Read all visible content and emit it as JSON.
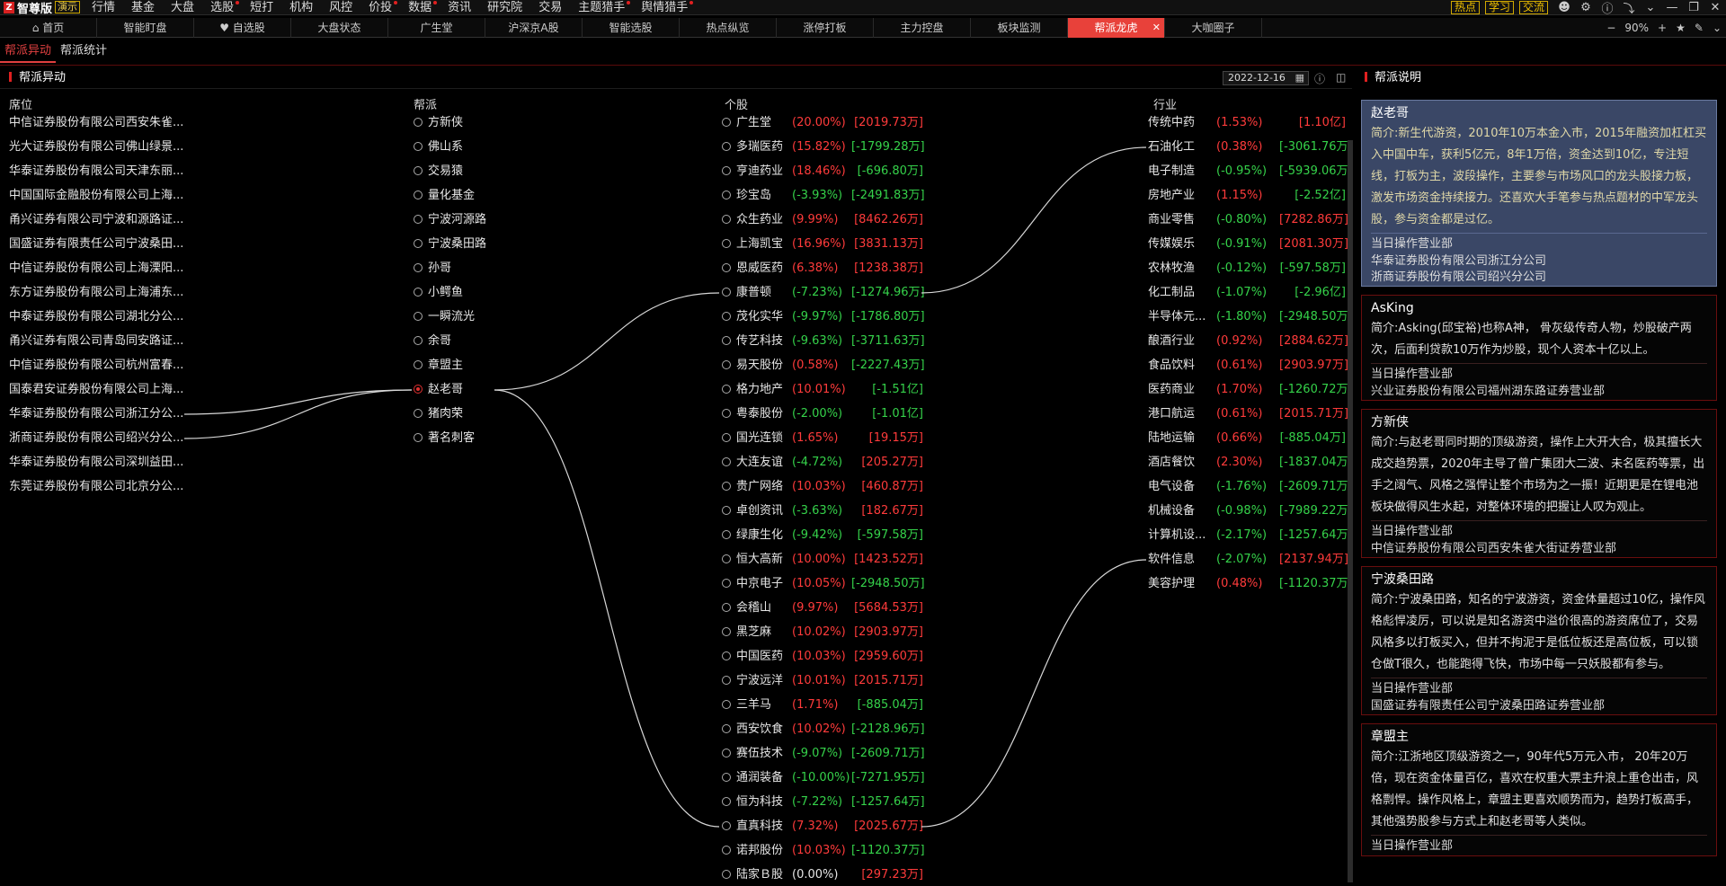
{
  "app": {
    "name": "智尊版",
    "badge": "演示"
  },
  "menu": [
    "行情",
    "基金",
    "大盘",
    "选股",
    "短打",
    "机构",
    "风控",
    "价投",
    "数据",
    "资讯",
    "研究院",
    "交易",
    "主题猎手",
    "舆情猎手"
  ],
  "top_right": {
    "hot": "热点",
    "learn": "学习",
    "exchange": "交流"
  },
  "tabs": [
    "首页",
    "智能盯盘",
    "自选股",
    "大盘状态",
    "广生堂",
    "沪深京A股",
    "智能选股",
    "热点纵览",
    "涨停打板",
    "主力控盘",
    "板块监测",
    "帮派龙虎",
    "大咖圈子"
  ],
  "tabbar_right": {
    "minus": "−",
    "zoom": "90%",
    "plus": "+"
  },
  "subtabs": [
    "帮派异动",
    "帮派统计"
  ],
  "left_panel": {
    "title": "帮派异动",
    "date": "2022-12-16"
  },
  "columns": {
    "seat": "席位",
    "faction": "帮派",
    "stock": "个股",
    "industry": "行业"
  },
  "seats": [
    "中信证券股份有限公司西安朱雀...",
    "光大证券股份有限公司佛山绿景...",
    "华泰证券股份有限公司天津东丽...",
    "中国国际金融股份有限公司上海...",
    "甬兴证券有限公司宁波和源路证...",
    "国盛证券有限责任公司宁波桑田...",
    "中信证券股份有限公司上海溧阳...",
    "东方证券股份有限公司上海浦东...",
    "中泰证券股份有限公司湖北分公...",
    "甬兴证券有限公司青岛同安路证...",
    "中信证券股份有限公司杭州富春...",
    "国泰君安证券股份有限公司上海...",
    "华泰证券股份有限公司浙江分公...",
    "浙商证券股份有限公司绍兴分公...",
    "华泰证券股份有限公司深圳益田...",
    "东莞证券股份有限公司北京分公..."
  ],
  "factions": [
    "方新侠",
    "佛山系",
    "交易猿",
    "量化基金",
    "宁波河源路",
    "宁波桑田路",
    "孙哥",
    "小鳄鱼",
    "一瞬流光",
    "余哥",
    "章盟主",
    "赵老哥",
    "猪肉荣",
    "著名刺客"
  ],
  "selected_faction": "赵老哥",
  "stocks": [
    {
      "name": "广生堂",
      "pct": "(20.00%)",
      "amt": "[2019.73万]",
      "pc": "red",
      "ac": "red"
    },
    {
      "name": "多瑞医药",
      "pct": "(15.82%)",
      "amt": "[-1799.28万]",
      "pc": "red",
      "ac": "green"
    },
    {
      "name": "亨迪药业",
      "pct": "(18.46%)",
      "amt": "[-696.80万]",
      "pc": "red",
      "ac": "green"
    },
    {
      "name": "珍宝岛",
      "pct": "(-3.93%)",
      "amt": "[-2491.83万]",
      "pc": "green",
      "ac": "green"
    },
    {
      "name": "众生药业",
      "pct": "(9.99%)",
      "amt": "[8462.26万]",
      "pc": "red",
      "ac": "red"
    },
    {
      "name": "上海凯宝",
      "pct": "(16.96%)",
      "amt": "[3831.13万]",
      "pc": "red",
      "ac": "red"
    },
    {
      "name": "恩威医药",
      "pct": "(6.38%)",
      "amt": "[1238.38万]",
      "pc": "red",
      "ac": "red"
    },
    {
      "name": "康普顿",
      "pct": "(-7.23%)",
      "amt": "[-1274.96万]",
      "pc": "green",
      "ac": "green"
    },
    {
      "name": "茂化实华",
      "pct": "(-9.97%)",
      "amt": "[-1786.80万]",
      "pc": "green",
      "ac": "green"
    },
    {
      "name": "传艺科技",
      "pct": "(-9.63%)",
      "amt": "[-3711.63万]",
      "pc": "green",
      "ac": "green"
    },
    {
      "name": "易天股份",
      "pct": "(0.58%)",
      "amt": "[-2227.43万]",
      "pc": "red",
      "ac": "green"
    },
    {
      "name": "格力地产",
      "pct": "(10.01%)",
      "amt": "[-1.51亿]",
      "pc": "red",
      "ac": "green"
    },
    {
      "name": "粤泰股份",
      "pct": "(-2.00%)",
      "amt": "[-1.01亿]",
      "pc": "green",
      "ac": "green"
    },
    {
      "name": "国光连锁",
      "pct": "(1.65%)",
      "amt": "[19.15万]",
      "pc": "red",
      "ac": "red"
    },
    {
      "name": "大连友谊",
      "pct": "(-4.72%)",
      "amt": "[205.27万]",
      "pc": "green",
      "ac": "red"
    },
    {
      "name": "贵广网络",
      "pct": "(10.03%)",
      "amt": "[460.87万]",
      "pc": "red",
      "ac": "red"
    },
    {
      "name": "卓创资讯",
      "pct": "(-3.63%)",
      "amt": "[182.67万]",
      "pc": "green",
      "ac": "red"
    },
    {
      "name": "绿康生化",
      "pct": "(-9.42%)",
      "amt": "[-597.58万]",
      "pc": "green",
      "ac": "green"
    },
    {
      "name": "恒大高新",
      "pct": "(10.00%)",
      "amt": "[1423.52万]",
      "pc": "red",
      "ac": "red"
    },
    {
      "name": "中京电子",
      "pct": "(10.05%)",
      "amt": "[-2948.50万]",
      "pc": "red",
      "ac": "green"
    },
    {
      "name": "会稽山",
      "pct": "(9.97%)",
      "amt": "[5684.53万]",
      "pc": "red",
      "ac": "red"
    },
    {
      "name": "黑芝麻",
      "pct": "(10.02%)",
      "amt": "[2903.97万]",
      "pc": "red",
      "ac": "red"
    },
    {
      "name": "中国医药",
      "pct": "(10.03%)",
      "amt": "[2959.60万]",
      "pc": "red",
      "ac": "red"
    },
    {
      "name": "宁波远洋",
      "pct": "(10.01%)",
      "amt": "[2015.71万]",
      "pc": "red",
      "ac": "red"
    },
    {
      "name": "三羊马",
      "pct": "(1.71%)",
      "amt": "[-885.04万]",
      "pc": "red",
      "ac": "green"
    },
    {
      "name": "西安饮食",
      "pct": "(10.02%)",
      "amt": "[-2128.96万]",
      "pc": "red",
      "ac": "green"
    },
    {
      "name": "赛伍技术",
      "pct": "(-9.07%)",
      "amt": "[-2609.71万]",
      "pc": "green",
      "ac": "green"
    },
    {
      "name": "通润装备",
      "pct": "(-10.00%)",
      "amt": "[-7271.95万]",
      "pc": "green",
      "ac": "green"
    },
    {
      "name": "恒为科技",
      "pct": "(-7.22%)",
      "amt": "[-1257.64万]",
      "pc": "green",
      "ac": "green"
    },
    {
      "name": "直真科技",
      "pct": "(7.32%)",
      "amt": "[2025.67万]",
      "pc": "red",
      "ac": "red"
    },
    {
      "name": "诺邦股份",
      "pct": "(10.03%)",
      "amt": "[-1120.37万]",
      "pc": "red",
      "ac": "green"
    },
    {
      "name": "陆家Ｂ股",
      "pct": "(0.00%)",
      "amt": "[297.23万]",
      "pc": "white",
      "ac": "red"
    }
  ],
  "industries": [
    {
      "name": "传统中药",
      "pct": "(1.53%)",
      "amt": "[1.10亿]",
      "pc": "red",
      "ac": "red"
    },
    {
      "name": "石油化工",
      "pct": "(0.38%)",
      "amt": "[-3061.76万]",
      "pc": "red",
      "ac": "green"
    },
    {
      "name": "电子制造",
      "pct": "(-0.95%)",
      "amt": "[-5939.06万]",
      "pc": "green",
      "ac": "green"
    },
    {
      "name": "房地产业",
      "pct": "(1.15%)",
      "amt": "[-2.52亿]",
      "pc": "red",
      "ac": "green"
    },
    {
      "name": "商业零售",
      "pct": "(-0.80%)",
      "amt": "[7282.86万]",
      "pc": "green",
      "ac": "red"
    },
    {
      "name": "传媒娱乐",
      "pct": "(-0.91%)",
      "amt": "[2081.30万]",
      "pc": "green",
      "ac": "red"
    },
    {
      "name": "农林牧渔",
      "pct": "(-0.12%)",
      "amt": "[-597.58万]",
      "pc": "green",
      "ac": "green"
    },
    {
      "name": "化工制品",
      "pct": "(-1.07%)",
      "amt": "[-2.96亿]",
      "pc": "green",
      "ac": "green"
    },
    {
      "name": "半导体元...",
      "pct": "(-1.80%)",
      "amt": "[-2948.50万]",
      "pc": "green",
      "ac": "green"
    },
    {
      "name": "酿酒行业",
      "pct": "(0.92%)",
      "amt": "[2884.62万]",
      "pc": "red",
      "ac": "red"
    },
    {
      "name": "食品饮料",
      "pct": "(0.61%)",
      "amt": "[2903.97万]",
      "pc": "red",
      "ac": "red"
    },
    {
      "name": "医药商业",
      "pct": "(1.70%)",
      "amt": "[-1260.72万]",
      "pc": "red",
      "ac": "green"
    },
    {
      "name": "港口航运",
      "pct": "(0.61%)",
      "amt": "[2015.71万]",
      "pc": "red",
      "ac": "red"
    },
    {
      "name": "陆地运输",
      "pct": "(0.66%)",
      "amt": "[-885.04万]",
      "pc": "red",
      "ac": "green"
    },
    {
      "name": "酒店餐饮",
      "pct": "(2.30%)",
      "amt": "[-1837.04万]",
      "pc": "red",
      "ac": "green"
    },
    {
      "name": "电气设备",
      "pct": "(-1.76%)",
      "amt": "[-2609.71万]",
      "pc": "green",
      "ac": "green"
    },
    {
      "name": "机械设备",
      "pct": "(-0.98%)",
      "amt": "[-7989.22万]",
      "pc": "green",
      "ac": "green"
    },
    {
      "name": "计算机设...",
      "pct": "(-2.17%)",
      "amt": "[-1257.64万]",
      "pc": "green",
      "ac": "green"
    },
    {
      "name": "软件信息",
      "pct": "(-2.07%)",
      "amt": "[2137.94万]",
      "pc": "green",
      "ac": "red"
    },
    {
      "name": "美容护理",
      "pct": "(0.48%)",
      "amt": "[-1120.37万]",
      "pc": "red",
      "ac": "green"
    }
  ],
  "links": {
    "seat_rows": [
      12,
      13
    ],
    "faction_row": 11,
    "stock_rows": [
      7,
      29
    ],
    "industry_rows": [
      1,
      18
    ]
  },
  "right_panel": {
    "title": "帮派说明",
    "op_label": "当日操作营业部",
    "cards": [
      {
        "name": "赵老哥",
        "desc": "简介:新生代游资，2010年10万本金入市，2015年融资加杠杠买入中国中车，获利5亿元，8年1万倍，资金达到10亿，专注短线，打板为主，波段操作，主要参与市场风口的龙头股接力板，激发市场资金持续接力。还喜欢大手笔参与热点题材的中军龙头股，参与资金都是过亿。",
        "brokers": [
          "华泰证券股份有限公司浙江分公司",
          "浙商证券股份有限公司绍兴分公司"
        ]
      },
      {
        "name": "AsKing",
        "desc": "简介:Asking(邱宝裕)也称A神， 骨灰级传奇人物，炒股破产两次，后面利贷款10万作为炒股，现个人资本十亿以上。",
        "brokers": [
          "兴业证券股份有限公司福州湖东路证券营业部"
        ]
      },
      {
        "name": "方新侠",
        "desc": "简介:与赵老哥同时期的顶级游资，操作上大开大合，极其擅长大成交趋势票，2020年主导了曾广集团大二波、未名医药等票，出手之阔气、风格之强悍让整个市场为之一振！近期更是在锂电池板块做得风生水起，对整体环境的把握让人叹为观止。",
        "brokers": [
          "中信证券股份有限公司西安朱雀大街证券营业部"
        ]
      },
      {
        "name": "宁波桑田路",
        "desc": "简介:宁波桑田路，知名的宁波游资，资金体量超过10亿，操作风格彪悍凌厉，可以说是知名游资中溢价很高的游资席位了，交易风格多以打板买入，但并不拘泥于是低位板还是高位板，可以锁仓做T很久，也能跑得飞快，市场中每一只妖股都有参与。",
        "brokers": [
          "国盛证券有限责任公司宁波桑田路证券营业部"
        ]
      },
      {
        "name": "章盟主",
        "desc": "简介:江浙地区顶级游资之一，90年代5万元入市， 20年20万倍，现在资金体量百亿，喜欢在权重大票主升浪上重仓出击，风格剽悍。操作风格上，章盟主更喜欢顺势而为，趋势打板高手，其他强势股参与方式上和赵老哥等人类似。",
        "brokers": []
      }
    ]
  },
  "colors": {
    "accent": "#e8413a",
    "up": "#ff3b3b",
    "down": "#35d24a",
    "selected_card": "#3a4766"
  }
}
